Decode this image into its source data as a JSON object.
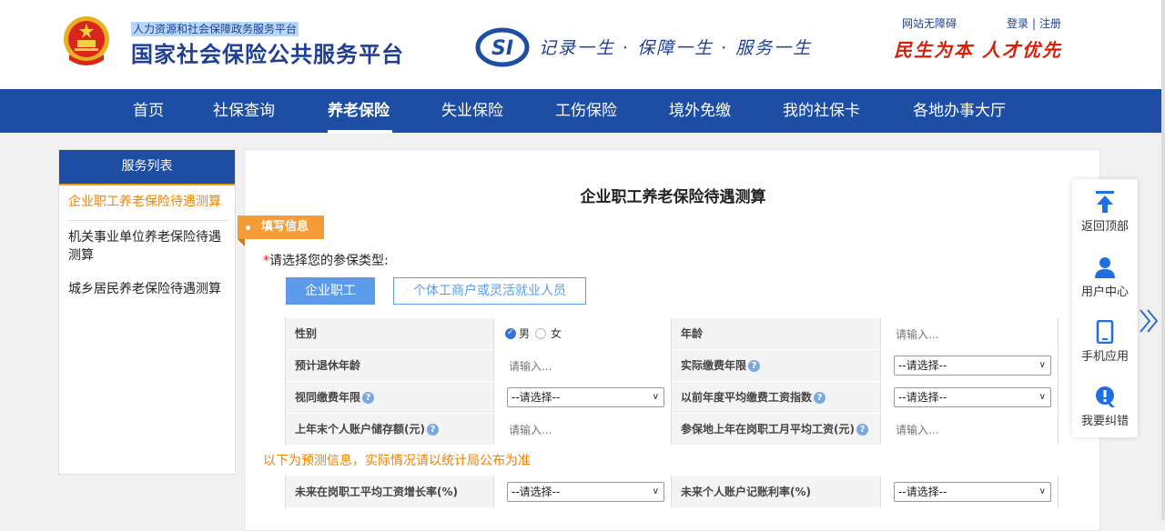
{
  "header": {
    "subtitle": "人力资源和社会保障政务服务平台",
    "title": "国家社会保险公共服务平台",
    "slogan": "记录一生 · 保障一生 · 服务一生",
    "accessibility_link": "网站无障碍",
    "login_link": "登录",
    "register_link": "注册",
    "separator": "|",
    "motto": "民生为本 人才优先",
    "logo_letters": "SI"
  },
  "nav": {
    "items": [
      "首页",
      "社保查询",
      "养老保险",
      "失业保险",
      "工伤保险",
      "境外免缴",
      "我的社保卡",
      "各地办事大厅"
    ],
    "active": "养老保险"
  },
  "sidebar": {
    "title": "服务列表",
    "items": [
      "企业职工养老保险待遇测算",
      "机关事业单位养老保险待遇测算",
      "城乡居民养老保险待遇测算"
    ],
    "active_index": 0
  },
  "main": {
    "page_title": "企业职工养老保险待遇测算",
    "section_tag": "填写信息",
    "type_question": "请选择您的参保类型:",
    "required_mark": "*",
    "type_options": [
      "企业职工",
      "个体工商户或灵活就业人员"
    ],
    "type_selected": "企业职工",
    "form": {
      "gender_label": "性别",
      "gender_male": "男",
      "gender_female": "女",
      "gender_selected": "男",
      "age_label": "年龄",
      "age_placeholder": "请输入...",
      "retire_age_label": "预计退休年龄",
      "retire_age_placeholder": "请输入...",
      "actual_years_label": "实际缴费年限",
      "actual_years_value": "--请选择--",
      "deemed_years_label": "视同缴费年限",
      "deemed_years_value": "--请选择--",
      "avg_index_label": "以前年度平均缴费工资指数",
      "avg_index_value": "--请选择--",
      "balance_label": "上年末个人账户储存额(元)",
      "balance_placeholder": "请输入...",
      "avg_wage_label": "参保地上年在岗职工月平均工资(元)",
      "avg_wage_placeholder": "请输入..."
    },
    "forecast_note": "以下为预测信息，实际情况请以统计局公布为准",
    "forecast": {
      "wage_growth_label": "未来在岗职工平均工资增长率(%)",
      "wage_growth_value": "--请选择--",
      "interest_label": "未来个人账户记账利率(%)",
      "interest_value": "--请选择--"
    }
  },
  "float_toolbar": {
    "items": [
      {
        "label": "返回顶部",
        "icon": "arrow-up-icon"
      },
      {
        "label": "用户中心",
        "icon": "user-icon"
      },
      {
        "label": "手机应用",
        "icon": "mobile-icon"
      },
      {
        "label": "我要纠错",
        "icon": "error-report-icon"
      }
    ]
  },
  "colors": {
    "brand_blue": "#1e4da4",
    "accent_orange": "#f08200",
    "button_blue": "#5b9bea",
    "motto_red": "#d81e06"
  }
}
